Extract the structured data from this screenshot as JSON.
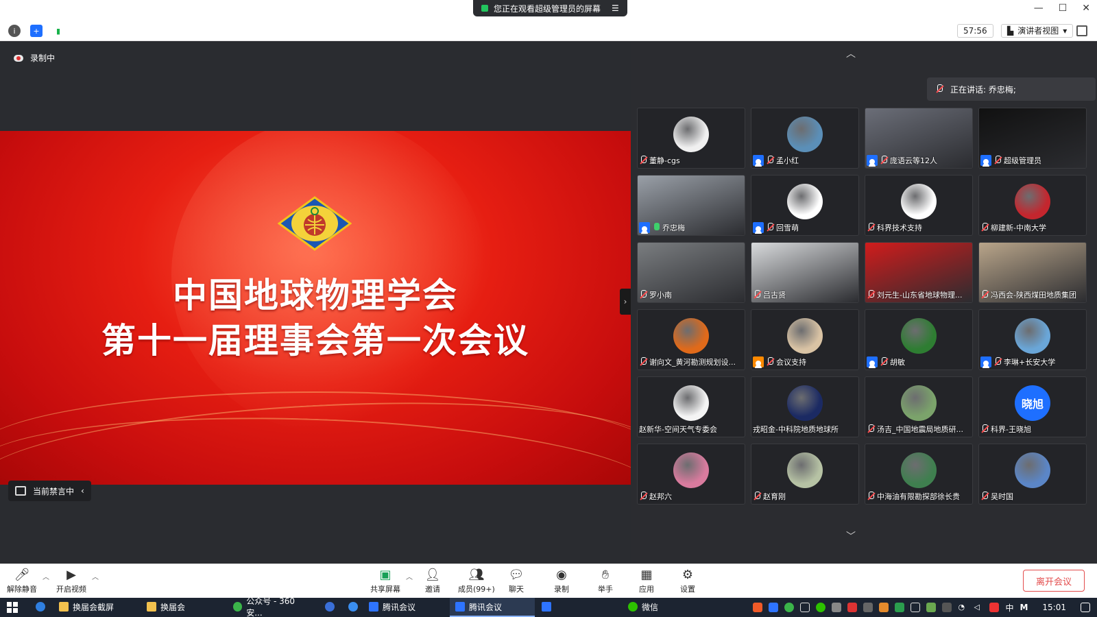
{
  "window": {
    "share_banner": "您正在观看超级管理员的屏幕",
    "menu_icon": "menu-icon",
    "controls": [
      "minimize-icon",
      "maximize-icon",
      "close-icon"
    ]
  },
  "infobar": {
    "icons": [
      "info-icon",
      "shield-icon",
      "signal-icon"
    ],
    "timer": "57:56",
    "view_mode": "演讲者视图",
    "fullscreen_icon": "fullscreen-icon"
  },
  "share": {
    "recording_label": "录制中",
    "slide_title_line1": "中国地球物理学会",
    "slide_title_line2": "第十一届理事会第一次会议",
    "mute_status": "当前禁言中"
  },
  "panel": {
    "speaking_label": "正在讲话: 乔忠梅;",
    "participants": [
      {
        "name": "董静-cgs",
        "host": false,
        "mic": "off",
        "bg": "#f0f0f0",
        "kind": "avatar"
      },
      {
        "name": "孟小红",
        "host": true,
        "mic": "off",
        "bg": "#5b8fb8",
        "kind": "avatar"
      },
      {
        "name": "庞语云等12人",
        "host": true,
        "mic": "off",
        "bg": "#6b6e78",
        "kind": "video"
      },
      {
        "name": "超级管理员",
        "host": true,
        "mic": "off",
        "bg": "#111111",
        "kind": "video"
      },
      {
        "name": "乔忠梅",
        "host": true,
        "mic": "on",
        "bg": "#9aa0a8",
        "kind": "video"
      },
      {
        "name": "回雪萌",
        "host": true,
        "mic": "off",
        "bg": "#ffffff",
        "kind": "avatar"
      },
      {
        "name": "科界技术支持",
        "host": false,
        "mic": "off",
        "bg": "#ffffff",
        "kind": "avatar"
      },
      {
        "name": "柳建新-中南大学",
        "host": false,
        "mic": "off",
        "bg": "#c4262e",
        "kind": "avatar"
      },
      {
        "name": "罗小南",
        "host": false,
        "mic": "off",
        "bg": "#7a7d80",
        "kind": "video"
      },
      {
        "name": "吕古贤",
        "host": false,
        "mic": "off",
        "bg": "#d8dadc",
        "kind": "video"
      },
      {
        "name": "刘元生-山东省地球物理...",
        "host": false,
        "mic": "off",
        "bg": "#d11c1c",
        "kind": "video"
      },
      {
        "name": "冯西会-陕西煤田地质集团",
        "host": false,
        "mic": "off",
        "bg": "#b9a58a",
        "kind": "video"
      },
      {
        "name": "谢向文_黄河勘测规划设...",
        "host": false,
        "mic": "off",
        "bg": "#e06a1a",
        "kind": "avatar"
      },
      {
        "name": "会议支持",
        "host": true,
        "orange": true,
        "mic": "off",
        "bg": "#d9c3a4",
        "kind": "avatar"
      },
      {
        "name": "胡敏",
        "host": true,
        "mic": "off",
        "bg": "#2e7d32",
        "kind": "avatar"
      },
      {
        "name": "李琳+长安大学",
        "host": true,
        "mic": "off",
        "bg": "#6aa6d8",
        "kind": "avatar"
      },
      {
        "name": "赵新华-空间天气专委会",
        "host": false,
        "mic": "none",
        "bg": "#f4f4f4",
        "kind": "avatar"
      },
      {
        "name": "戎昭金-中科院地质地球所",
        "host": false,
        "mic": "none",
        "bg": "#1b2a63",
        "kind": "avatar"
      },
      {
        "name": "汤吉_中国地震局地质研...",
        "host": false,
        "mic": "off",
        "bg": "#7ba36b",
        "kind": "avatar"
      },
      {
        "name": "科界-王晓旭",
        "host": false,
        "mic": "off",
        "bg": "#1e6fff",
        "kind": "avatar",
        "initials": "晓旭"
      },
      {
        "name": "赵邦六",
        "host": false,
        "mic": "off",
        "bg": "#d97b9e",
        "kind": "avatar"
      },
      {
        "name": "赵育刚",
        "host": false,
        "mic": "off",
        "bg": "#b6c2a4",
        "kind": "avatar"
      },
      {
        "name": "中海油有限勘探部徐长贵",
        "host": false,
        "mic": "off",
        "bg": "#3f7f4f",
        "kind": "avatar"
      },
      {
        "name": "吴时国",
        "host": false,
        "mic": "off",
        "bg": "#5b86c7",
        "kind": "avatar"
      }
    ]
  },
  "toolbar": {
    "unmute": "解除静音",
    "start_video": "开启视频",
    "share_screen": "共享屏幕",
    "invite": "邀请",
    "members": "成员(99+)",
    "chat": "聊天",
    "record": "录制",
    "raise_hand": "举手",
    "apps": "应用",
    "settings": "设置",
    "leave": "离开会议"
  },
  "taskbar": {
    "items": [
      "换届会截屏",
      "换届会",
      "公众号 - 360安...",
      "腾讯会议",
      "腾讯会议",
      "微信"
    ],
    "ime": "中",
    "clock": "15:01"
  },
  "colors": {
    "accent": "#1e6fff",
    "leave": "#e34b4b",
    "slide_red": "#e61e12",
    "panel_bg": "#2b2c30"
  }
}
